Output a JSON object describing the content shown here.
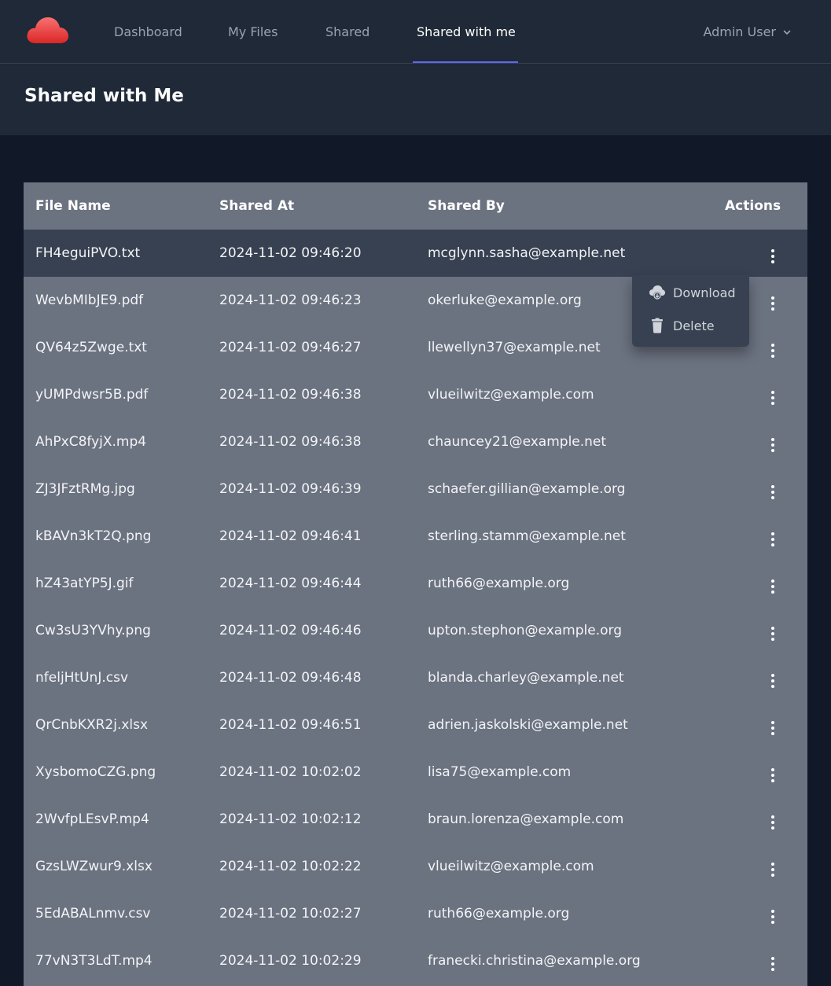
{
  "nav": {
    "links": [
      "Dashboard",
      "My Files",
      "Shared",
      "Shared with me"
    ],
    "active": "Shared with me",
    "user": "Admin User"
  },
  "page": {
    "title": "Shared with Me"
  },
  "table": {
    "columns": [
      "File Name",
      "Shared At",
      "Shared By",
      "Actions"
    ],
    "rows": [
      {
        "name": "FH4eguiPVO.txt",
        "date": "2024-11-02 09:46:20",
        "by": "mcglynn.sasha@example.net"
      },
      {
        "name": "WevbMIbJE9.pdf",
        "date": "2024-11-02 09:46:23",
        "by": "okerluke@example.org"
      },
      {
        "name": "QV64z5Zwge.txt",
        "date": "2024-11-02 09:46:27",
        "by": "llewellyn37@example.net"
      },
      {
        "name": "yUMPdwsr5B.pdf",
        "date": "2024-11-02 09:46:38",
        "by": "vlueilwitz@example.com"
      },
      {
        "name": "AhPxC8fyjX.mp4",
        "date": "2024-11-02 09:46:38",
        "by": "chauncey21@example.net"
      },
      {
        "name": "ZJ3JFztRMg.jpg",
        "date": "2024-11-02 09:46:39",
        "by": "schaefer.gillian@example.org"
      },
      {
        "name": "kBAVn3kT2Q.png",
        "date": "2024-11-02 09:46:41",
        "by": "sterling.stamm@example.net"
      },
      {
        "name": "hZ43atYP5J.gif",
        "date": "2024-11-02 09:46:44",
        "by": "ruth66@example.org"
      },
      {
        "name": "Cw3sU3YVhy.png",
        "date": "2024-11-02 09:46:46",
        "by": "upton.stephon@example.org"
      },
      {
        "name": "nfeljHtUnJ.csv",
        "date": "2024-11-02 09:46:48",
        "by": "blanda.charley@example.net"
      },
      {
        "name": "QrCnbKXR2j.xlsx",
        "date": "2024-11-02 09:46:51",
        "by": "adrien.jaskolski@example.net"
      },
      {
        "name": "XysbomoCZG.png",
        "date": "2024-11-02 10:02:02",
        "by": "lisa75@example.com"
      },
      {
        "name": "2WvfpLEsvP.mp4",
        "date": "2024-11-02 10:02:12",
        "by": "braun.lorenza@example.com"
      },
      {
        "name": "GzsLWZwur9.xlsx",
        "date": "2024-11-02 10:02:22",
        "by": "vlueilwitz@example.com"
      },
      {
        "name": "5EdABALnmv.csv",
        "date": "2024-11-02 10:02:27",
        "by": "ruth66@example.org"
      },
      {
        "name": "77vN3T3LdT.mp4",
        "date": "2024-11-02 10:02:29",
        "by": "franecki.christina@example.org"
      }
    ]
  },
  "dropdown": {
    "items": [
      {
        "label": "Download",
        "icon": "cloud-download-icon"
      },
      {
        "label": "Delete",
        "icon": "trash-icon"
      }
    ]
  },
  "colors": {
    "background": "#111827",
    "navbar": "#1f2937",
    "table": "#6b7280",
    "row_highlight": "#374151",
    "accent": "#6366f1",
    "logo": "#ef4444"
  }
}
